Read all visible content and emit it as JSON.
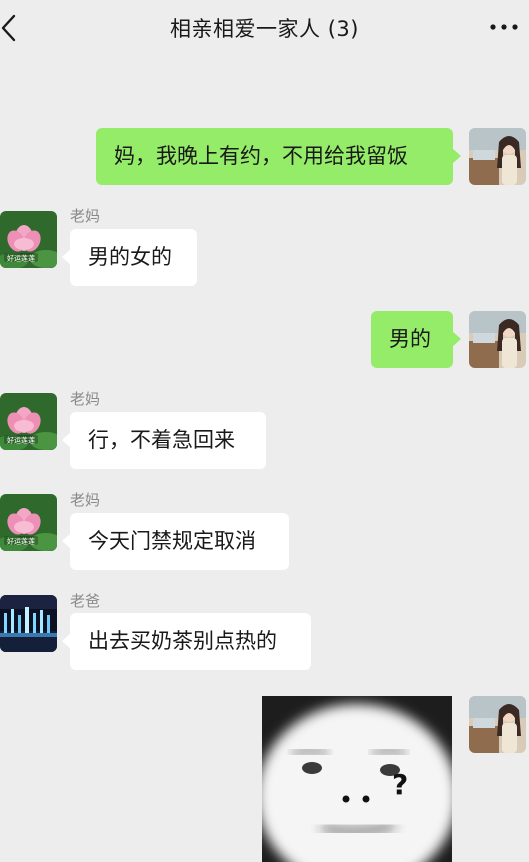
{
  "header": {
    "title": "相亲相爱一家人 (3)",
    "back_icon": "chevron-left-icon",
    "more_icon": "more-dots-icon"
  },
  "messages": [
    {
      "side": "outgoing",
      "text": "妈，我晚上有约，不用给我留饭"
    },
    {
      "side": "incoming",
      "sender": "老妈",
      "text": "男的女的",
      "avatar_caption": "好运莲莲"
    },
    {
      "side": "outgoing",
      "text": "男的"
    },
    {
      "side": "incoming",
      "sender": "老妈",
      "text": "行，不着急回来",
      "avatar_caption": "好运莲莲"
    },
    {
      "side": "incoming",
      "sender": "老妈",
      "text": "今天门禁规定取消",
      "avatar_caption": "好运莲莲"
    },
    {
      "side": "incoming",
      "sender": "老爸",
      "text": "出去买奶茶别点热的"
    },
    {
      "side": "outgoing",
      "type": "sticker",
      "sticker_text": "? "
    }
  ],
  "colors": {
    "background": "#ededed",
    "outgoing_bubble": "#95ec69",
    "incoming_bubble": "#ffffff",
    "sender_name": "#8a8a8a"
  }
}
